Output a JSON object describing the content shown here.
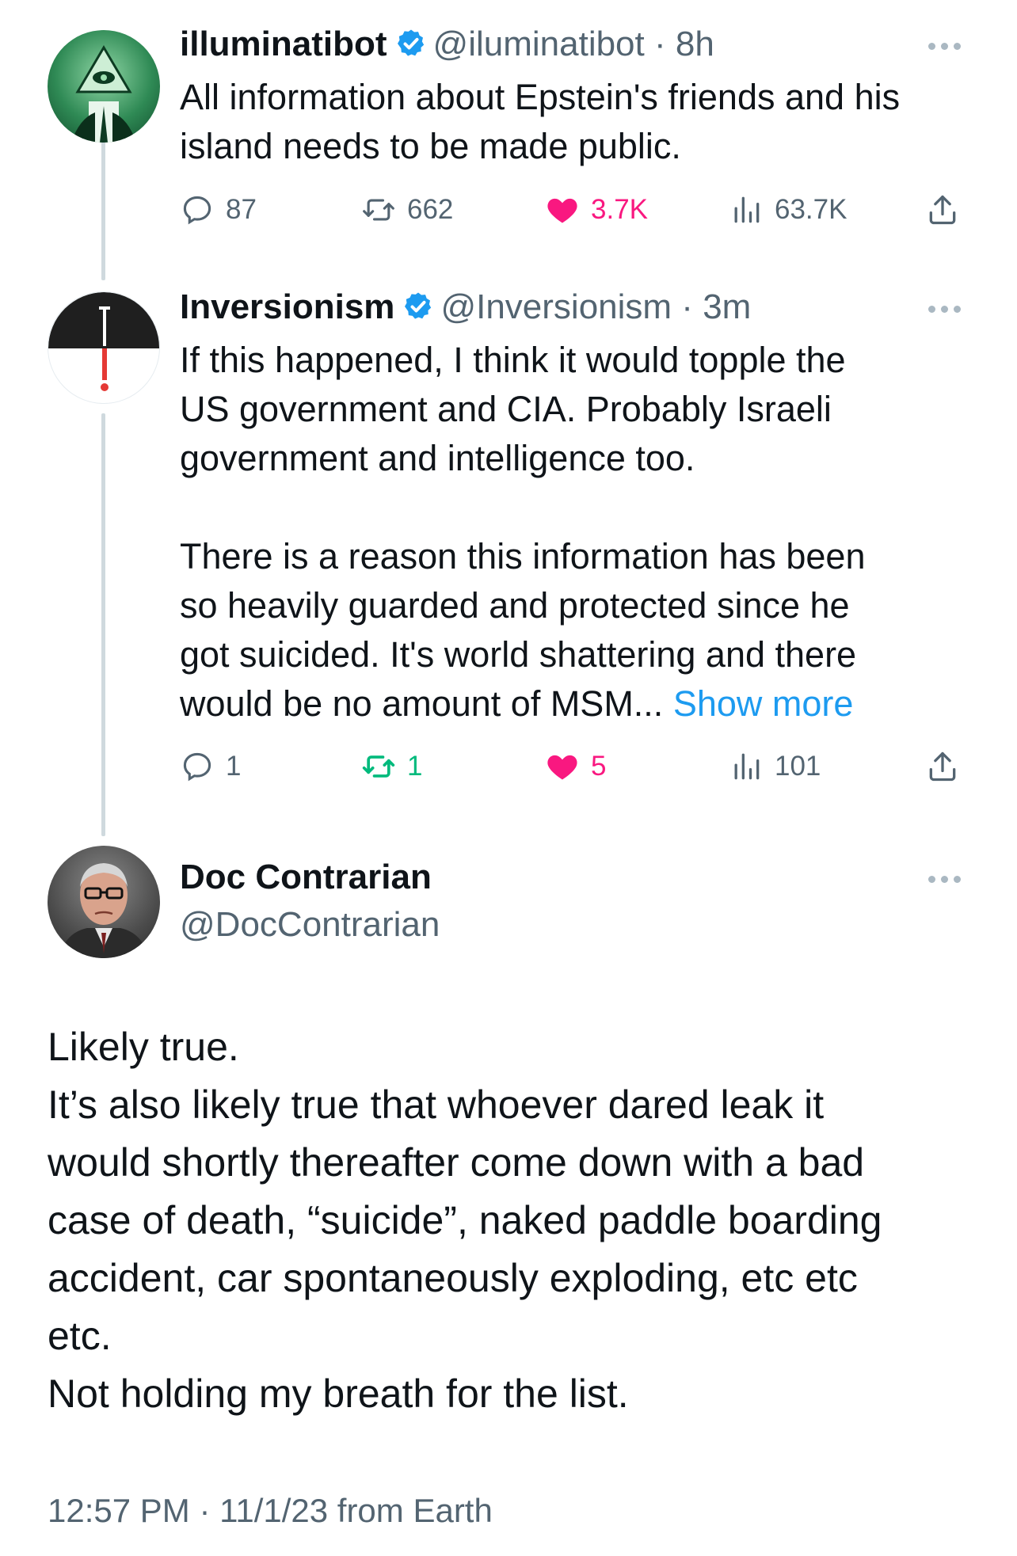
{
  "tweets": [
    {
      "display_name": "illuminatibot",
      "handle": "@iluminatibot",
      "time": "8h",
      "body": [
        "All information about Epstein's friends and his",
        "island needs to be made public."
      ],
      "replies": "87",
      "retweets": "662",
      "likes": "3.7K",
      "views": "63.7K"
    },
    {
      "display_name": "Inversionism",
      "handle": "@Inversionism",
      "time": "3m",
      "body_p1": [
        "If this happened, I think it would topple the",
        "US government and CIA. Probably Israeli",
        "government and intelligence too."
      ],
      "body_p2": [
        "There is a reason this information has been",
        "so heavily guarded and protected since he",
        "got suicided. It's world shattering and there"
      ],
      "body_p2_last": "would be no amount of MSM...",
      "show_more": "Show more",
      "replies": "1",
      "retweets": "1",
      "likes": "5",
      "views": "101"
    }
  ],
  "main_tweet": {
    "display_name": "Doc Contrarian",
    "handle": "@DocContrarian",
    "body": [
      "Likely true.",
      "It’s also likely true that whoever dared leak it",
      "would shortly thereafter come down with a bad",
      "case of death, “suicide”, naked paddle boarding",
      "accident, car spontaneously exploding, etc etc",
      "etc.",
      "Not holding my breath for the list."
    ],
    "timestamp": "12:57 PM · 11/1/23 from Earth"
  },
  "colors": {
    "text": "#0f1419",
    "secondary": "#536471",
    "link": "#1d9bf0",
    "like": "#f91880",
    "retweet_active": "#00ba7c",
    "verified": "#1d9bf0"
  },
  "icons": [
    "verified-badge-icon",
    "more-options-icon",
    "reply-icon",
    "retweet-icon",
    "like-icon",
    "views-icon",
    "share-icon"
  ]
}
